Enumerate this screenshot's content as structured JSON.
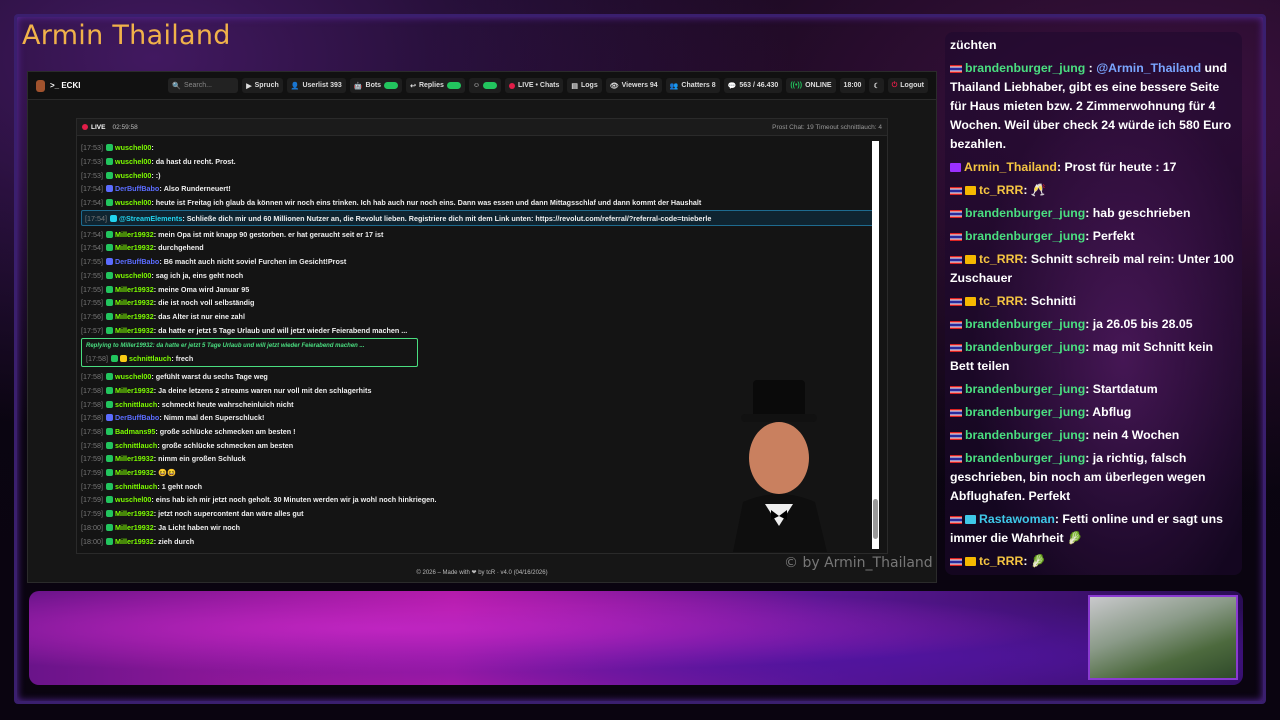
{
  "overlay": {
    "title": "Armin Thailand",
    "watermark": "© by Armin_Thailand"
  },
  "app": {
    "navbar": {
      "brand": ">_ ECKI",
      "search_placeholder": "Search...",
      "items": [
        "Spruch",
        "Userlist 393",
        "Bots",
        "Replies",
        "LIVE • Chats",
        "Logs",
        "Viewers 94",
        "Chatters 8",
        "563 / 46.430",
        "ONLINE",
        "18:00",
        "Logout"
      ]
    },
    "chat_header": {
      "live_label": "LIVE",
      "uptime": "02:59:58",
      "right_text": "Prost Chat: 19   Timeout schnittlauch: 4"
    },
    "lines": [
      {
        "ts": "[17:53]",
        "user": "wuschel00",
        "text": "",
        "color": "green"
      },
      {
        "ts": "[17:53]",
        "user": "wuschel00",
        "text": "da hast du recht. Prost.",
        "color": "green"
      },
      {
        "ts": "[17:53]",
        "user": "wuschel00",
        "text": ":)",
        "color": "green"
      },
      {
        "ts": "[17:54]",
        "user": "DerBuffBabo",
        "text": "Also Runderneuert!",
        "color": "blue"
      },
      {
        "ts": "[17:54]",
        "user": "wuschel00",
        "text": "heute ist Freitag ich glaub da können wir noch eins trinken. Ich hab auch nur noch eins. Dann was essen und dann Mittagsschlaf und dann kommt der Haushalt",
        "color": "green"
      },
      {
        "ts": "[17:54]",
        "user": "@StreamElements",
        "text": "Schließe dich mir und 60 Millionen Nutzer an, die Revolut lieben. Registriere dich mit dem Link unten: https://revolut.com/referral/?referral-code=tnieberle",
        "color": "cyan",
        "highlight": true
      },
      {
        "ts": "[17:54]",
        "user": "Miller19932",
        "text": "mein Opa ist mit knapp 90 gestorben. er hat geraucht seit er 17 ist",
        "color": "green"
      },
      {
        "ts": "[17:54]",
        "user": "Miller19932",
        "text": "durchgehend",
        "color": "green"
      },
      {
        "ts": "[17:55]",
        "user": "DerBuffBabo",
        "text": "B6 macht auch nicht soviel Furchen im Gesicht!Prost",
        "color": "blue"
      },
      {
        "ts": "[17:55]",
        "user": "wuschel00",
        "text": "sag ich ja, eins geht noch",
        "color": "green"
      },
      {
        "ts": "[17:55]",
        "user": "Miller19932",
        "text": "meine Oma wird Januar 95",
        "color": "green"
      },
      {
        "ts": "[17:55]",
        "user": "Miller19932",
        "text": "die ist noch voll selbständig",
        "color": "green"
      },
      {
        "ts": "[17:56]",
        "user": "Miller19932",
        "text": "das Alter ist nur eine zahl",
        "color": "green"
      },
      {
        "ts": "[17:57]",
        "user": "Miller19932",
        "text": "da hatte er jetzt 5 Tage Urlaub und will jetzt wieder Feierabend machen ...",
        "color": "green"
      }
    ],
    "reply": {
      "reply_to": "Replying to Miller19932: da hatte er jetzt 5 Tage Urlaub und will jetzt wieder Feierabend machen ...",
      "ts": "[17:58]",
      "user": "schnittlauch",
      "text": "frech"
    },
    "lines2": [
      {
        "ts": "[17:58]",
        "user": "wuschel00",
        "text": "gefühlt warst du sechs Tage weg",
        "color": "green"
      },
      {
        "ts": "[17:58]",
        "user": "Miller19932",
        "text": "Ja deine letzens 2 streams waren nur voll mit den schlagerhits",
        "color": "green"
      },
      {
        "ts": "[17:58]",
        "user": "schnittlauch",
        "text": "schmeckt heute wahrscheinluich nicht",
        "color": "green"
      },
      {
        "ts": "[17:58]",
        "user": "DerBuffBabo",
        "text": "Nimm mal den Superschluck!",
        "color": "blue"
      },
      {
        "ts": "[17:58]",
        "user": "Badmans95",
        "text": "große schlücke schmecken am besten !",
        "color": "green"
      },
      {
        "ts": "[17:58]",
        "user": "schnittlauch",
        "text": "große schlücke schmecken am besten",
        "color": "green"
      },
      {
        "ts": "[17:59]",
        "user": "Miller19932",
        "text": "nimm ein großen Schluck",
        "color": "green"
      },
      {
        "ts": "[17:59]",
        "user": "Miller19932",
        "text": "😆😆",
        "color": "green"
      },
      {
        "ts": "[17:59]",
        "user": "schnittlauch",
        "text": "1 geht noch",
        "color": "green"
      },
      {
        "ts": "[17:59]",
        "user": "wuschel00",
        "text": "eins hab ich mir jetzt noch geholt. 30 Minuten werden wir ja wohl noch hinkriegen.",
        "color": "green"
      },
      {
        "ts": "[17:59]",
        "user": "Miller19932",
        "text": "jetzt noch supercontent dan wäre alles gut",
        "color": "green"
      },
      {
        "ts": "[18:00]",
        "user": "Miller19932",
        "text": "Ja Licht haben wir noch",
        "color": "green"
      },
      {
        "ts": "[18:00]",
        "user": "Miller19932",
        "text": "zieh durch",
        "color": "green"
      }
    ],
    "footer": "© 2026 – Made with ❤ by tcR · v4.0 (04/16/2026)"
  },
  "side_chat": [
    {
      "user": "",
      "text": "züchten",
      "kind": "plain"
    },
    {
      "user": "brandenburger_jung",
      "mention": "@Armin_Thailand",
      "text": " und Thailand Liebhaber, gibt es eine bessere Seite für Haus mieten bzw. 2 Zimmerwohnung für 4 Wochen. Weil über check 24 würde ich 580 Euro bezahlen.",
      "kind": "flag"
    },
    {
      "user": "Armin_Thailand",
      "text": ": Prost für heute : 17",
      "kind": "gold"
    },
    {
      "user": "tc_RRR",
      "text": ": 🥂",
      "kind": "crown"
    },
    {
      "user": "brandenburger_jung",
      "text": ": hab geschrieben",
      "kind": "flag"
    },
    {
      "user": "brandenburger_jung",
      "text": ": Perfekt",
      "kind": "flag"
    },
    {
      "user": "tc_RRR",
      "text": ": Schnitt schreib mal rein: Unter 100 Zuschauer",
      "kind": "crown"
    },
    {
      "user": "tc_RRR",
      "text": ": Schnitti",
      "kind": "crown"
    },
    {
      "user": "brandenburger_jung",
      "text": ": ja 26.05 bis 28.05",
      "kind": "flag"
    },
    {
      "user": "brandenburger_jung",
      "text": ": mag mit Schnitt kein Bett teilen",
      "kind": "flag"
    },
    {
      "user": "brandenburger_jung",
      "text": ": Startdatum",
      "kind": "flag"
    },
    {
      "user": "brandenburger_jung",
      "text": ": Abflug",
      "kind": "flag"
    },
    {
      "user": "brandenburger_jung",
      "text": ": nein 4 Wochen",
      "kind": "flag"
    },
    {
      "user": "brandenburger_jung",
      "text": ": ja richtig, falsch geschrieben, bin noch am überlegen wegen Abflughafen. Perfekt",
      "kind": "flag"
    },
    {
      "user": "Rastawoman",
      "text": ": Fetti online und er sagt uns immer die Wahrheit 🥬",
      "kind": "teal"
    },
    {
      "user": "tc_RRR",
      "text": ": 🥬",
      "kind": "crown"
    }
  ]
}
